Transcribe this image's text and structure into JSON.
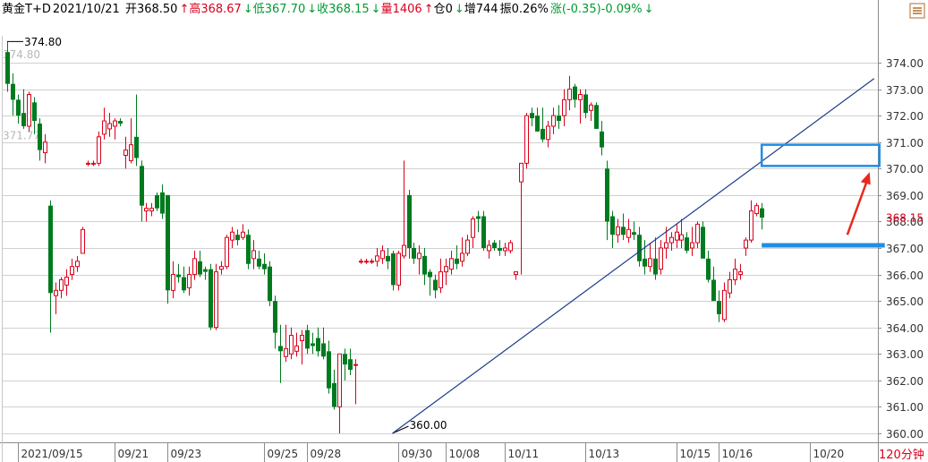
{
  "header": {
    "symbol": "黄金T+D",
    "date": "2021/10/21",
    "open": "开368.50",
    "open_arrow": "↑",
    "high": "高368.67",
    "high_arrow": "↓",
    "low": "低367.70",
    "low_arrow": "↓",
    "close": "收368.15",
    "close_arrow": "↓",
    "volume": "量1406",
    "volume_arrow": "↑",
    "position": "仓0",
    "position_arrow": "↓",
    "increase": "增744",
    "amplitude": "振0.26%",
    "change": "涨(-0.35)-0.09%",
    "change_arrow": "↓"
  },
  "period_label": "120分钟",
  "colors": {
    "up": "#d9001b",
    "down": "#007a1f",
    "grid": "#d0d0d0",
    "trendline": "#1c3d8c",
    "box": "#1f8ee6",
    "support": "#1f8ee6",
    "arrow": "#e8281e",
    "last_price": "#d9001b"
  },
  "icons": {
    "settings": "settings-icon"
  },
  "chart_data": {
    "type": "candlestick",
    "ylim": [
      359.6,
      375.4
    ],
    "y_ticks": [
      "374.00",
      "373.00",
      "372.00",
      "371.00",
      "370.00",
      "369.00",
      "368.00",
      "367.00",
      "366.00",
      "365.00",
      "364.00",
      "363.00",
      "362.00",
      "361.00",
      "360.00"
    ],
    "x_ticks": [
      {
        "label": "2021/09/15",
        "index": 2
      },
      {
        "label": "09/21",
        "index": 20
      },
      {
        "label": "09/23",
        "index": 30
      },
      {
        "label": "09/25",
        "index": 48
      },
      {
        "label": "09/28",
        "index": 56
      },
      {
        "label": "09/30",
        "index": 73
      },
      {
        "label": "10/08",
        "index": 82
      },
      {
        "label": "10/11",
        "index": 93
      },
      {
        "label": "10/13",
        "index": 108
      },
      {
        "label": "10/15",
        "index": 125
      },
      {
        "label": "10/16",
        "index": 133
      },
      {
        "label": "10/20",
        "index": 150
      }
    ],
    "annotations": {
      "max_label": "374.80",
      "max_value": 374.8,
      "max_index": 0,
      "min_label": "360.00",
      "min_value": 360.0,
      "min_index": 72,
      "last_price_label": "368.15",
      "last_price": 368.15,
      "faded_labels": [
        {
          "text": "374.80",
          "value": 374.3,
          "index": 0
        },
        {
          "text": "371.77",
          "value": 371.25,
          "index": 0
        }
      ]
    },
    "trendline": {
      "from": {
        "index": 72,
        "value": 360.0
      },
      "to": {
        "index": 162,
        "value": 373.4
      }
    },
    "resistance_zone": {
      "index_start": 141,
      "index_end": 163,
      "value_top": 370.9,
      "value_bottom": 370.1
    },
    "support_line": {
      "index_start": 141,
      "index_end": 164,
      "value": 367.1
    },
    "projection_arrow": {
      "from": {
        "index": 157,
        "value": 367.5
      },
      "to": {
        "index": 161,
        "value": 369.8
      }
    },
    "candles": [
      [
        374.4,
        374.8,
        372.9,
        373.2
      ],
      [
        373.2,
        373.6,
        372.0,
        372.6
      ],
      [
        372.6,
        372.8,
        371.7,
        372.0
      ],
      [
        372.1,
        373.0,
        371.5,
        371.6
      ],
      [
        371.6,
        372.9,
        371.4,
        372.8
      ],
      [
        372.5,
        372.7,
        371.3,
        371.8
      ],
      [
        371.7,
        371.9,
        370.3,
        370.7
      ],
      [
        370.6,
        371.3,
        370.2,
        371.0
      ],
      [
        368.6,
        368.8,
        363.8,
        365.3
      ],
      [
        365.2,
        365.7,
        364.5,
        365.4
      ],
      [
        365.4,
        365.9,
        365.1,
        365.8
      ],
      [
        365.6,
        366.2,
        365.2,
        365.9
      ],
      [
        366.0,
        366.6,
        365.8,
        366.3
      ],
      [
        366.3,
        366.7,
        366.1,
        366.5
      ],
      [
        366.8,
        367.8,
        366.8,
        367.7
      ],
      [
        370.2,
        370.3,
        370.1,
        370.2
      ],
      [
        370.2,
        370.3,
        370.1,
        370.2
      ],
      [
        370.2,
        371.4,
        370.1,
        371.2
      ],
      [
        371.3,
        372.3,
        371.1,
        371.8
      ],
      [
        371.5,
        372.1,
        371.2,
        371.7
      ],
      [
        371.6,
        371.9,
        371.1,
        371.8
      ],
      [
        371.8,
        371.9,
        371.6,
        371.7
      ],
      [
        370.5,
        371.2,
        370.0,
        370.7
      ],
      [
        370.3,
        371.9,
        370.2,
        370.9
      ],
      [
        371.2,
        372.8,
        370.1,
        370.4
      ],
      [
        370.1,
        370.3,
        368.0,
        368.6
      ],
      [
        368.4,
        368.7,
        368.0,
        368.5
      ],
      [
        368.4,
        368.7,
        368.2,
        368.5
      ],
      [
        369.0,
        369.1,
        368.4,
        368.5
      ],
      [
        369.1,
        369.4,
        368.1,
        368.3
      ],
      [
        369.0,
        369.0,
        364.9,
        365.4
      ],
      [
        365.4,
        366.5,
        365.1,
        366.0
      ],
      [
        366.0,
        366.4,
        365.7,
        365.9
      ],
      [
        365.9,
        366.3,
        365.3,
        365.4
      ],
      [
        365.5,
        366.3,
        365.2,
        366.0
      ],
      [
        366.0,
        366.9,
        365.8,
        366.6
      ],
      [
        366.5,
        366.9,
        365.9,
        366.0
      ],
      [
        366.2,
        366.3,
        365.8,
        366.1
      ],
      [
        366.2,
        366.4,
        363.9,
        364.0
      ],
      [
        364.0,
        366.4,
        363.9,
        366.1
      ],
      [
        366.2,
        366.5,
        366.0,
        366.3
      ],
      [
        366.3,
        367.5,
        366.2,
        367.4
      ],
      [
        367.3,
        367.8,
        367.0,
        367.6
      ],
      [
        367.5,
        367.7,
        367.1,
        367.3
      ],
      [
        367.4,
        367.9,
        367.3,
        367.6
      ],
      [
        367.5,
        367.7,
        366.2,
        366.4
      ],
      [
        366.6,
        367.3,
        366.2,
        366.9
      ],
      [
        366.6,
        366.9,
        366.2,
        366.3
      ],
      [
        366.4,
        366.8,
        366.0,
        366.2
      ],
      [
        366.3,
        366.5,
        364.8,
        365.0
      ],
      [
        365.0,
        365.2,
        363.2,
        363.8
      ],
      [
        363.3,
        364.1,
        361.9,
        363.1
      ],
      [
        362.9,
        364.1,
        362.7,
        363.2
      ],
      [
        363.0,
        364.0,
        362.8,
        363.7
      ],
      [
        363.1,
        363.8,
        362.9,
        363.3
      ],
      [
        363.5,
        363.9,
        362.6,
        363.7
      ],
      [
        363.9,
        364.1,
        363.0,
        363.2
      ],
      [
        363.4,
        363.8,
        363.0,
        363.3
      ],
      [
        363.6,
        364.0,
        362.9,
        363.1
      ],
      [
        363.4,
        364.0,
        362.8,
        362.9
      ],
      [
        363.1,
        363.5,
        361.5,
        361.7
      ],
      [
        361.9,
        362.4,
        360.9,
        361.0
      ],
      [
        361.0,
        362.3,
        360.0,
        363.0
      ],
      [
        363.0,
        363.2,
        362.0,
        362.6
      ],
      [
        362.8,
        363.2,
        362.2,
        362.4
      ],
      [
        362.6,
        362.8,
        361.1,
        362.6
      ],
      [
        366.5,
        366.6,
        366.4,
        366.5
      ],
      [
        366.5,
        366.6,
        366.4,
        366.5
      ],
      [
        366.5,
        366.6,
        366.4,
        366.5
      ],
      [
        366.5,
        367.0,
        366.3,
        366.7
      ],
      [
        366.6,
        367.1,
        366.4,
        366.9
      ],
      [
        366.7,
        367.0,
        366.2,
        366.5
      ],
      [
        366.8,
        366.9,
        365.4,
        365.6
      ],
      [
        365.6,
        366.9,
        365.4,
        366.8
      ],
      [
        366.7,
        370.3,
        366.6,
        367.1
      ],
      [
        369.0,
        369.2,
        366.6,
        367.0
      ],
      [
        367.0,
        367.2,
        366.4,
        366.6
      ],
      [
        366.6,
        367.1,
        366.0,
        366.8
      ],
      [
        366.7,
        367.0,
        365.6,
        366.0
      ],
      [
        366.1,
        366.2,
        365.2,
        365.9
      ],
      [
        365.8,
        366.0,
        365.1,
        365.4
      ],
      [
        365.5,
        366.6,
        365.3,
        366.1
      ],
      [
        366.1,
        366.6,
        365.6,
        366.3
      ],
      [
        366.2,
        366.9,
        366.0,
        366.6
      ],
      [
        366.6,
        367.1,
        366.2,
        366.4
      ],
      [
        366.5,
        367.4,
        366.3,
        366.8
      ],
      [
        366.8,
        367.5,
        366.7,
        367.3
      ],
      [
        367.4,
        368.2,
        367.0,
        368.1
      ],
      [
        368.2,
        368.4,
        367.6,
        368.1
      ],
      [
        368.2,
        368.4,
        366.9,
        367.0
      ],
      [
        366.9,
        367.3,
        366.6,
        367.1
      ],
      [
        367.2,
        367.3,
        366.9,
        367.0
      ],
      [
        367.0,
        367.3,
        366.7,
        366.9
      ],
      [
        366.9,
        367.2,
        366.7,
        367.0
      ],
      [
        366.9,
        367.3,
        366.8,
        367.2
      ],
      [
        366.0,
        366.1,
        365.8,
        366.1
      ],
      [
        369.5,
        369.6,
        366.0,
        370.2
      ],
      [
        370.2,
        372.1,
        370.0,
        372.0
      ],
      [
        372.1,
        372.3,
        371.6,
        371.9
      ],
      [
        372.0,
        372.3,
        371.4,
        371.4
      ],
      [
        371.5,
        372.3,
        371.0,
        371.1
      ],
      [
        371.1,
        371.8,
        370.8,
        371.6
      ],
      [
        371.6,
        372.3,
        371.3,
        372.0
      ],
      [
        372.0,
        372.4,
        371.5,
        371.8
      ],
      [
        372.0,
        373.0,
        371.6,
        372.6
      ],
      [
        372.6,
        373.5,
        372.2,
        373.0
      ],
      [
        373.1,
        373.2,
        372.3,
        372.6
      ],
      [
        372.6,
        373.0,
        371.7,
        372.8
      ],
      [
        372.8,
        373.0,
        371.9,
        372.1
      ],
      [
        372.2,
        372.5,
        371.8,
        372.4
      ],
      [
        372.4,
        372.5,
        371.8,
        371.5
      ],
      [
        371.4,
        371.8,
        370.5,
        370.8
      ],
      [
        370.0,
        370.3,
        367.3,
        368.0
      ],
      [
        368.2,
        368.4,
        367.0,
        367.5
      ],
      [
        367.5,
        368.1,
        367.2,
        367.8
      ],
      [
        367.8,
        368.3,
        367.3,
        367.5
      ],
      [
        367.4,
        368.1,
        367.2,
        367.7
      ],
      [
        367.6,
        368.0,
        367.3,
        367.5
      ],
      [
        367.5,
        367.8,
        366.3,
        366.5
      ],
      [
        366.6,
        367.3,
        366.0,
        366.3
      ],
      [
        366.3,
        367.2,
        366.1,
        366.6
      ],
      [
        366.6,
        367.4,
        365.8,
        366.0
      ],
      [
        366.2,
        367.3,
        366.0,
        367.0
      ],
      [
        367.0,
        367.8,
        366.6,
        367.2
      ],
      [
        367.2,
        367.6,
        366.9,
        367.4
      ],
      [
        367.3,
        367.9,
        367.0,
        367.6
      ],
      [
        367.3,
        368.1,
        367.0,
        367.5
      ],
      [
        367.4,
        367.6,
        366.8,
        366.9
      ],
      [
        367.0,
        367.8,
        366.7,
        367.2
      ],
      [
        367.2,
        368.0,
        367.0,
        367.9
      ],
      [
        367.8,
        368.0,
        366.8,
        366.6
      ],
      [
        366.6,
        366.9,
        365.7,
        365.8
      ],
      [
        365.8,
        366.3,
        365.0,
        365.0
      ],
      [
        365.0,
        365.4,
        364.2,
        364.5
      ],
      [
        364.3,
        365.7,
        364.2,
        365.4
      ],
      [
        365.3,
        366.1,
        365.1,
        365.8
      ],
      [
        365.8,
        366.6,
        365.6,
        366.2
      ],
      [
        366.0,
        366.4,
        365.8,
        366.1
      ],
      [
        367.0,
        367.4,
        366.7,
        367.3
      ],
      [
        367.3,
        368.8,
        367.2,
        368.4
      ],
      [
        368.3,
        368.7,
        368.2,
        368.6
      ],
      [
        368.5,
        368.7,
        367.7,
        368.15
      ]
    ]
  }
}
